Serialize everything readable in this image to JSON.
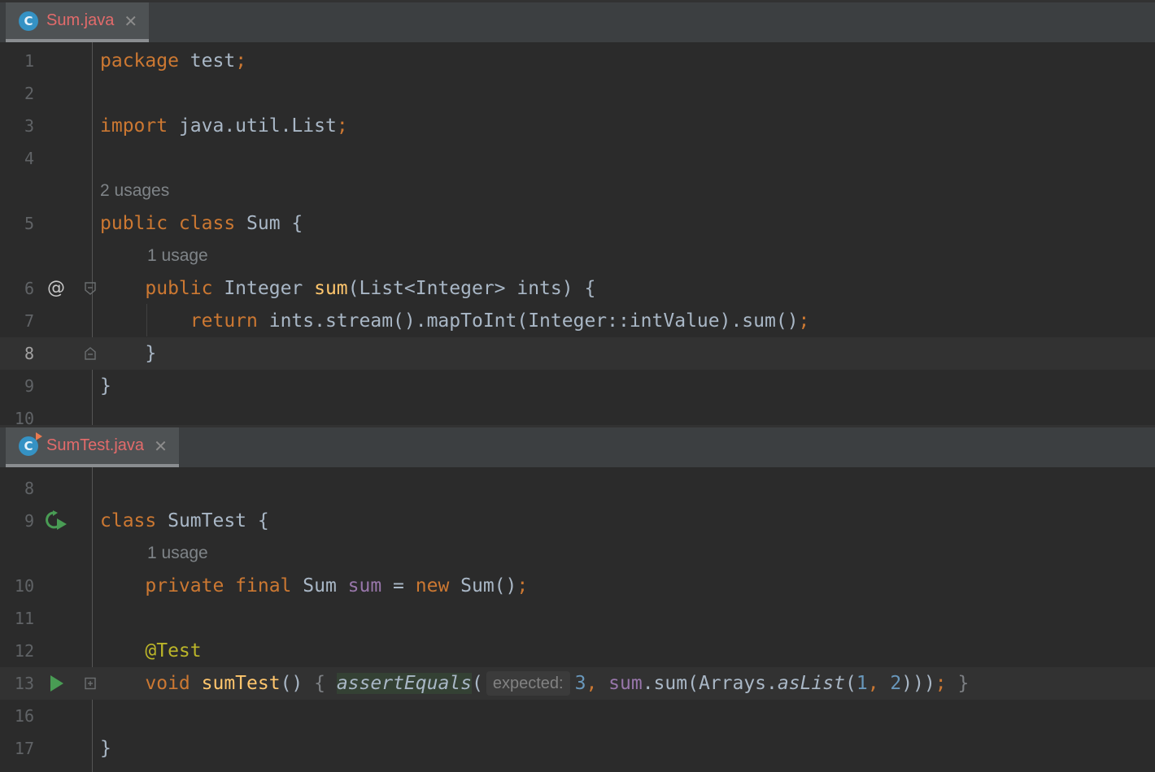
{
  "top_editor": {
    "tab": {
      "label": "Sum.java",
      "icon_letter": "C",
      "close_glyph": "✕"
    },
    "lines": {
      "l1": {
        "num": "1",
        "kw": "package",
        "rest": " test",
        "semi": ";"
      },
      "l2": {
        "num": "2"
      },
      "l3": {
        "num": "3",
        "kw": "import",
        "rest": " java.util.List",
        "semi": ";"
      },
      "l4": {
        "num": "4"
      },
      "hint_class": "2 usages",
      "l5": {
        "num": "5",
        "kw": "public class",
        "rest": " Sum {"
      },
      "hint_method": "1 usage",
      "l6": {
        "num": "6",
        "gutter_glyph": "@",
        "indent": "    ",
        "kw": "public",
        "type": " Integer ",
        "fn": "sum",
        "rest": "(List<Integer> ints) {"
      },
      "l7": {
        "num": "7",
        "indent": "        ",
        "kw": "return",
        "rest": " ints.stream().mapToInt(Integer::intValue).sum()",
        "semi": ";"
      },
      "l8": {
        "num": "8",
        "text": "    }"
      },
      "l9": {
        "num": "9",
        "text": "}"
      },
      "l10": {
        "num": "10"
      }
    }
  },
  "bottom_editor": {
    "tab": {
      "label": "SumTest.java",
      "icon_letter": "C",
      "close_glyph": "✕"
    },
    "lines": {
      "l8": {
        "num": "8"
      },
      "l9": {
        "num": "9",
        "kw": "class",
        "rest": " SumTest {"
      },
      "hint_field": "1 usage",
      "l10": {
        "num": "10",
        "indent": "    ",
        "kw": "private final",
        "type": " Sum ",
        "fld": "sum",
        "eq": " = ",
        "kw2": "new",
        "rest": " Sum()",
        "semi": ";"
      },
      "l11": {
        "num": "11"
      },
      "l12": {
        "num": "12",
        "indent": "    ",
        "ann": "@Test"
      },
      "l13": {
        "num": "13",
        "indent": "    ",
        "kw": "void",
        "fn": " sumTest",
        "parens": "() ",
        "brace_open": "{",
        "assert": "assertEquals",
        "paren": "(",
        "param_hint": "expected:",
        "num_3": "3",
        "comma1": ",",
        "fld": " sum",
        "call": ".sum(Arrays.",
        "aslist": "asList",
        "open": "(",
        "num_1": "1",
        "comma2": ", ",
        "num_2": "2",
        "close": ")))",
        "semi": ";",
        "brace_close": " }"
      },
      "l16": {
        "num": "16"
      },
      "l17": {
        "num": "17",
        "text": "}"
      }
    }
  }
}
